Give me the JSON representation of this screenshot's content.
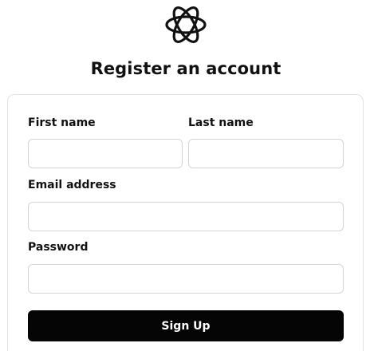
{
  "header": {
    "logo_icon": "atom-icon",
    "title": "Register an account"
  },
  "form": {
    "first_name": {
      "label": "First name",
      "value": "",
      "placeholder": ""
    },
    "last_name": {
      "label": "Last name",
      "value": "",
      "placeholder": ""
    },
    "email": {
      "label": "Email address",
      "value": "",
      "placeholder": ""
    },
    "password": {
      "label": "Password",
      "value": "",
      "placeholder": ""
    },
    "submit_label": "Sign Up"
  },
  "colors": {
    "button_background": "#050505",
    "button_text": "#ffffff",
    "input_border": "#d4d4d4",
    "card_border": "#e3e3e3"
  }
}
